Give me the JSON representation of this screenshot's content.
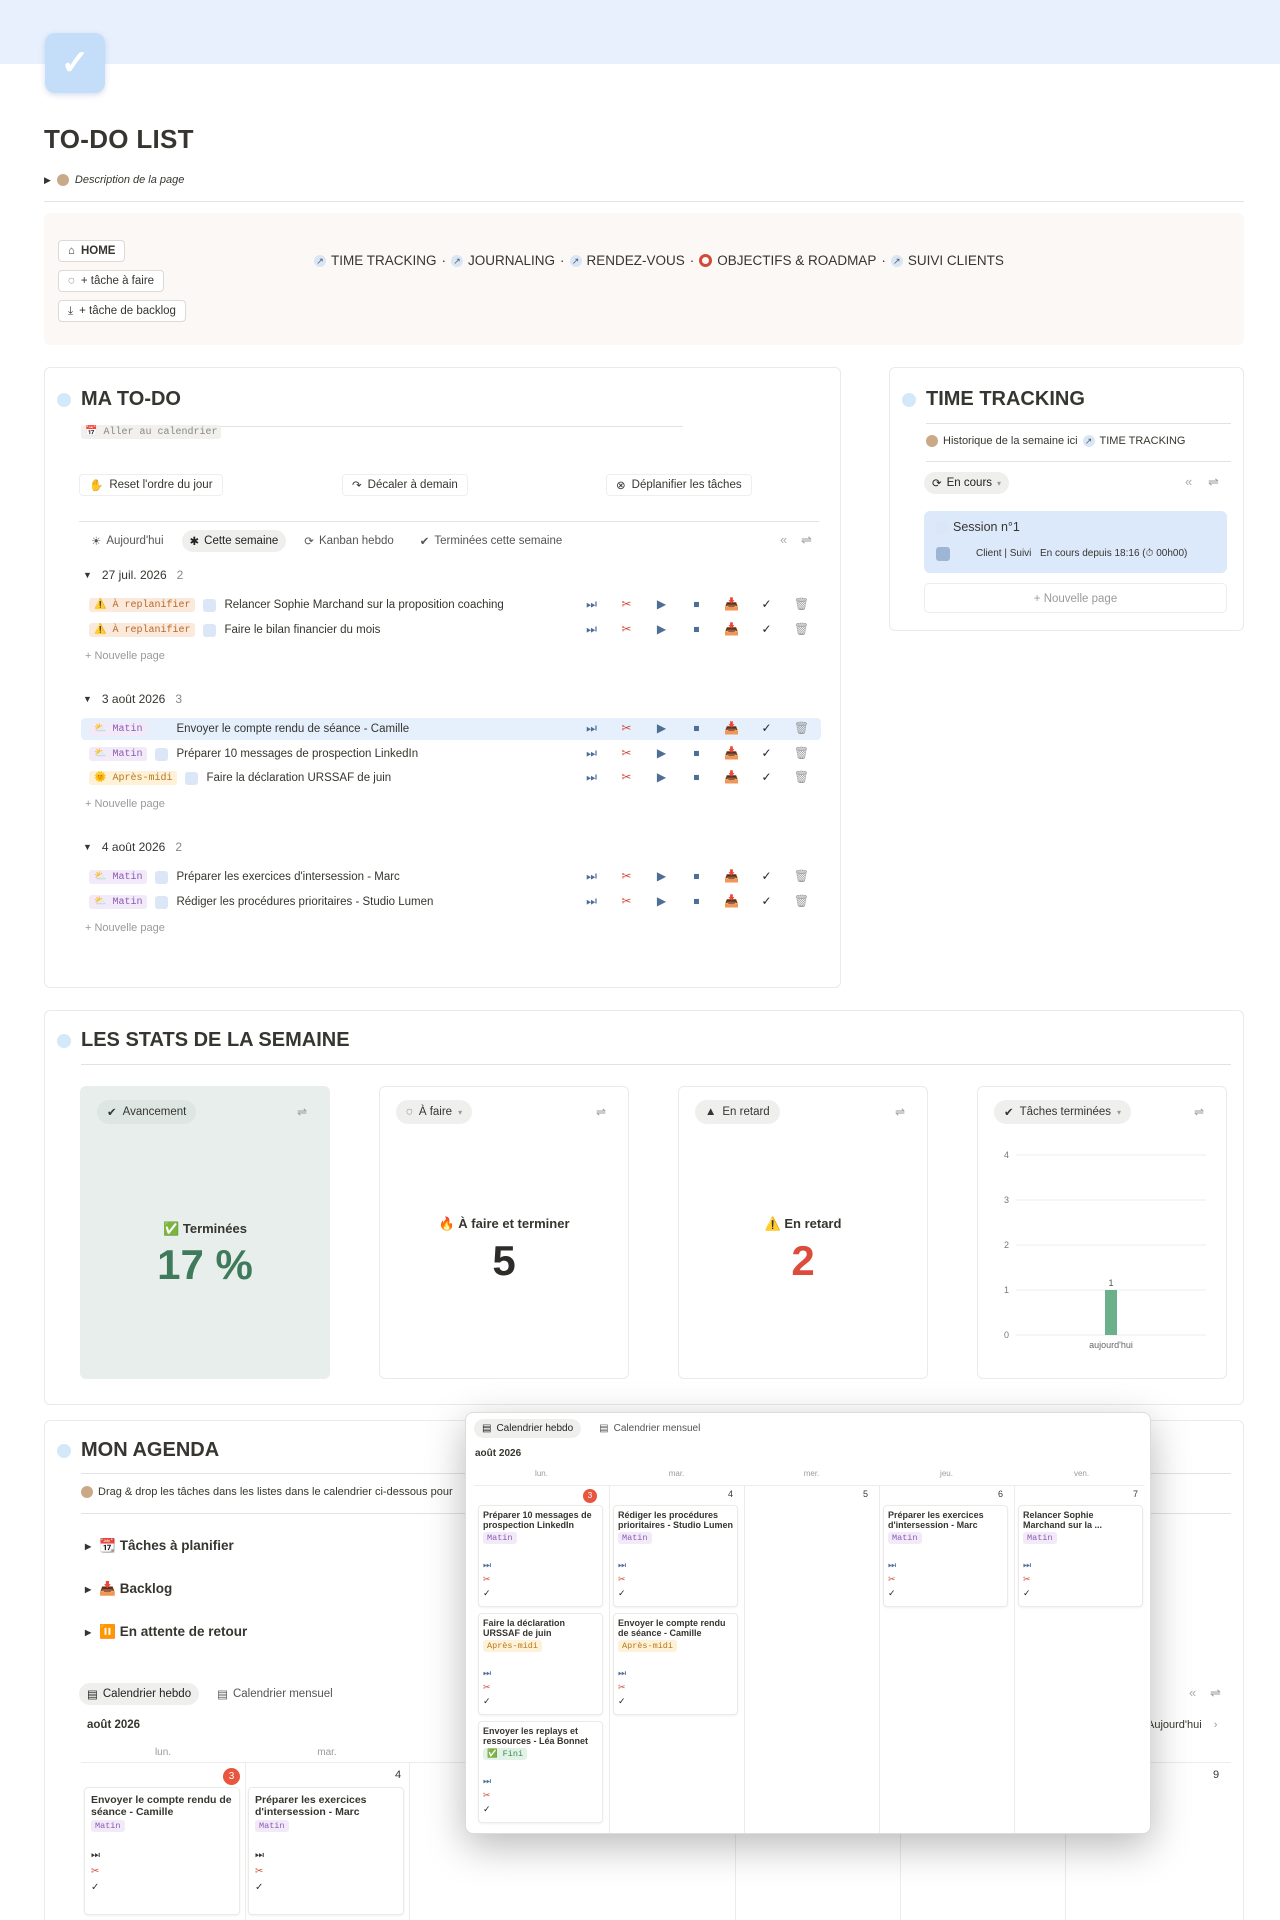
{
  "page": {
    "title": "TO-DO LIST",
    "description": "Description de la page"
  },
  "nav": {
    "home": "HOME",
    "add_task": "+ tâche à faire",
    "add_backlog": "+ tâche de backlog",
    "links": [
      "TIME TRACKING",
      "JOURNALING",
      "RENDEZ-VOUS",
      "OBJECTIFS & ROADMAP",
      "SUIVI CLIENTS"
    ],
    "separator": "·"
  },
  "todo": {
    "title": "MA TO-DO",
    "calendar_link": "📅 Aller au calendrier",
    "actions": [
      "Reset l'ordre du jour",
      "Décaler à demain",
      "Déplanifier les tâches"
    ],
    "tabs": [
      "Aujourd'hui",
      "Cette semaine",
      "Kanban hebdo",
      "Terminées cette semaine"
    ],
    "new_page": "+ Nouvelle page",
    "groups": [
      {
        "date": "27 juil. 2026",
        "count": "2",
        "rows": [
          {
            "tag": "⚠️ À replanifier",
            "text": "Relancer Sophie Marchand sur la proposition coaching"
          },
          {
            "tag": "⚠️ À replanifier",
            "text": "Faire le bilan financier du mois"
          }
        ]
      },
      {
        "date": "3 août 2026",
        "count": "3",
        "rows": [
          {
            "tag": "⛅ Matin",
            "text": "Envoyer le compte rendu de séance - Camille"
          },
          {
            "tag": "⛅ Matin",
            "text": "Préparer 10 messages de prospection LinkedIn"
          },
          {
            "tag": "🌞 Après-midi",
            "text": "Faire la déclaration URSSAF de juin"
          }
        ]
      },
      {
        "date": "4 août 2026",
        "count": "2",
        "rows": [
          {
            "tag": "⛅ Matin",
            "text": "Préparer les exercices d'intersession - Marc"
          },
          {
            "tag": "⛅ Matin",
            "text": "Rédiger les procédures prioritaires - Studio Lumen"
          }
        ]
      }
    ],
    "row_icons": [
      "⏭",
      "✂",
      "▶",
      "⏹",
      "📥",
      "✓",
      "🗑"
    ]
  },
  "time_tracking": {
    "title": "TIME TRACKING",
    "history": "Historique de la semaine ici",
    "history_link": "TIME TRACKING",
    "filter": "En cours",
    "session_title": "Session n°1",
    "session_client": "Client | Suivi",
    "session_status": "En cours depuis 18:16 (⏱ 00h00)",
    "new_page": "+ Nouvelle page"
  },
  "stats": {
    "title": "LES STATS DE LA SEMAINE",
    "cards": [
      {
        "chip": "Avancement",
        "label": "✅ Terminées",
        "value": "17 %"
      },
      {
        "chip": "À faire",
        "label": "🔥 À faire et terminer",
        "value": "5"
      },
      {
        "chip": "En retard",
        "label": "⚠️ En retard",
        "value": "2"
      },
      {
        "chip": "Tâches terminées"
      }
    ]
  },
  "chart_data": {
    "type": "bar",
    "categories": [
      "aujourd'hui"
    ],
    "values": [
      1
    ],
    "ylim": [
      0,
      4
    ],
    "yticks": [
      "0",
      "1",
      "2",
      "3",
      "4"
    ],
    "data_labels": [
      "1"
    ],
    "color": "#6bb08a"
  },
  "agenda": {
    "title": "MON AGENDA",
    "hint": "Drag & drop les tâches dans les listes dans le calendrier ci-dessous pour",
    "toggles": [
      "📆 Tâches à planifier",
      "📥 Backlog",
      "⏸️ En attente de retour"
    ],
    "tabs": [
      "Calendrier hebdo",
      "Calendrier mensuel"
    ],
    "month": "août 2026",
    "today_btn": "Aujourd'hui",
    "days": [
      "lun.",
      "mar."
    ],
    "day_nums": [
      "3",
      "4",
      "9"
    ],
    "events": [
      {
        "title": "Envoyer le compte rendu de séance - Camille",
        "tag": "Matin"
      },
      {
        "title": "Préparer les exercices d'intersession - Marc",
        "tag": "Matin"
      }
    ]
  },
  "popup": {
    "tabs": [
      "Calendrier hebdo",
      "Calendrier mensuel"
    ],
    "month": "août 2026",
    "days": [
      "lun.",
      "mar.",
      "mer.",
      "jeu.",
      "ven."
    ],
    "day_nums": [
      "3",
      "4",
      "5",
      "6",
      "7"
    ],
    "events": [
      {
        "title": "Préparer 10 messages de prospection LinkedIn",
        "tag": "Matin"
      },
      {
        "title": "Rédiger les procédures prioritaires - Studio Lumen",
        "tag": "Matin"
      },
      {
        "title": "Préparer les exercices d'intersession - Marc",
        "tag": "Matin"
      },
      {
        "title": "Relancer Sophie Marchand sur la ...",
        "tag": "Matin"
      },
      {
        "title": "Faire la déclaration URSSAF de juin",
        "tag": "Après-midi"
      },
      {
        "title": "Envoyer le compte rendu de séance - Camille",
        "tag": "Après-midi"
      },
      {
        "title": "Envoyer les replays et ressources - Léa Bonnet",
        "tag": "✅ Fini"
      }
    ]
  }
}
